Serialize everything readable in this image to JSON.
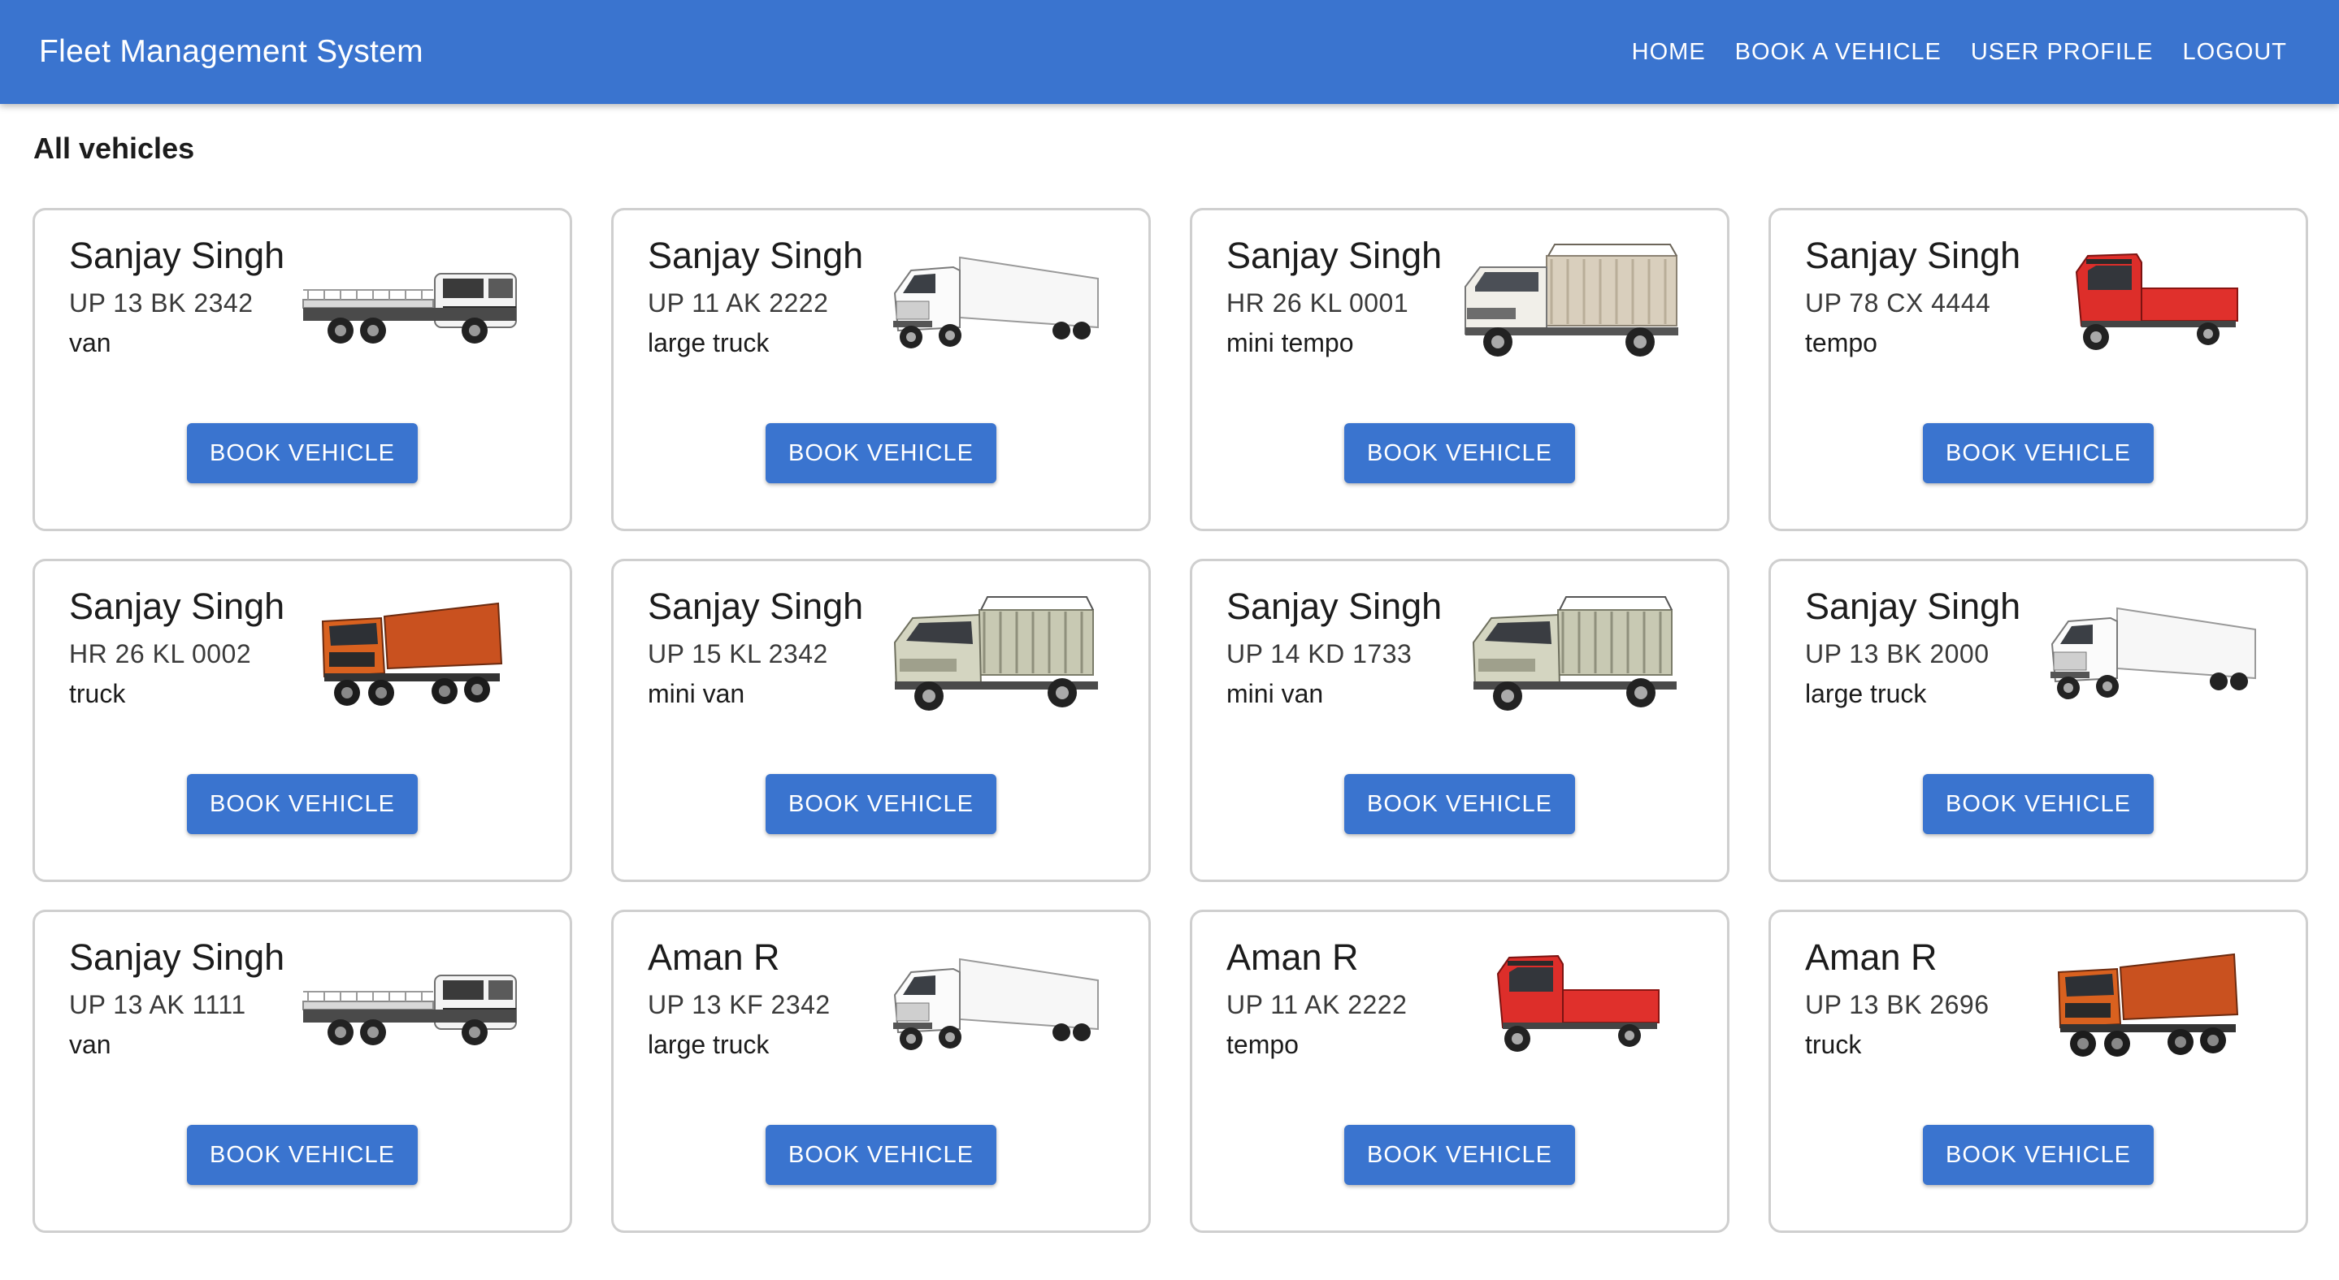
{
  "app": {
    "title": "Fleet Management System",
    "brand_color": "#3a74cf"
  },
  "nav": [
    {
      "label": "HOME"
    },
    {
      "label": "BOOK A VEHICLE"
    },
    {
      "label": "USER PROFILE"
    },
    {
      "label": "LOGOUT"
    }
  ],
  "page": {
    "heading": "All vehicles"
  },
  "vehicles": [
    {
      "owner": "Sanjay Singh",
      "reg": "UP 13 BK 2342",
      "type": "van",
      "image": "flatbed-truck-white",
      "button": "BOOK VEHICLE"
    },
    {
      "owner": "Sanjay Singh",
      "reg": "UP 11 AK 2222",
      "type": "large truck",
      "image": "semi-trailer-truck-white",
      "button": "BOOK VEHICLE"
    },
    {
      "owner": "Sanjay Singh",
      "reg": "HR 26 KL 0001",
      "type": "mini tempo",
      "image": "mini-tempo-beige",
      "button": "BOOK VEHICLE"
    },
    {
      "owner": "Sanjay Singh",
      "reg": "UP 78 CX 4444",
      "type": "tempo",
      "image": "three-wheeler-tempo-red",
      "button": "BOOK VEHICLE"
    },
    {
      "owner": "Sanjay Singh",
      "reg": "HR 26 KL 0002",
      "type": "truck",
      "image": "dump-truck-orange",
      "button": "BOOK VEHICLE"
    },
    {
      "owner": "Sanjay Singh",
      "reg": "UP 15 KL 2342",
      "type": "mini van",
      "image": "mini-van-grey",
      "button": "BOOK VEHICLE"
    },
    {
      "owner": "Sanjay Singh",
      "reg": "UP 14 KD 1733",
      "type": "mini van",
      "image": "mini-van-grey",
      "button": "BOOK VEHICLE"
    },
    {
      "owner": "Sanjay Singh",
      "reg": "UP 13 BK 2000",
      "type": "large truck",
      "image": "semi-trailer-truck-white",
      "button": "BOOK VEHICLE"
    },
    {
      "owner": "Sanjay Singh",
      "reg": "UP 13 AK 1111",
      "type": "van",
      "image": "flatbed-truck-white",
      "button": "BOOK VEHICLE"
    },
    {
      "owner": "Aman R",
      "reg": "UP 13 KF 2342",
      "type": "large truck",
      "image": "semi-trailer-truck-white",
      "button": "BOOK VEHICLE"
    },
    {
      "owner": "Aman R",
      "reg": "UP 11 AK 2222",
      "type": "tempo",
      "image": "three-wheeler-tempo-red",
      "button": "BOOK VEHICLE"
    },
    {
      "owner": "Aman R",
      "reg": "UP 13 BK 2696",
      "type": "truck",
      "image": "dump-truck-orange",
      "button": "BOOK VEHICLE"
    }
  ]
}
